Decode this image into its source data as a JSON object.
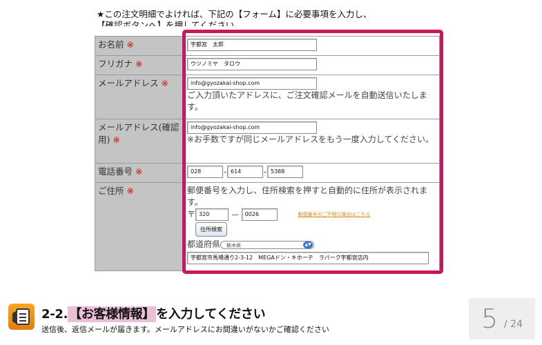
{
  "instruction": {
    "line1": "★この注文明細でよければ、下記の【フォーム】に必要事項を入力し、",
    "line2": "【確認ボタンへ】を押してください。"
  },
  "required_mark": "※",
  "form": {
    "name": {
      "label": "お名前",
      "value": "宇都宮　太郎"
    },
    "furigana": {
      "label": "フリガナ",
      "value": "ウツノミヤ　タロウ"
    },
    "email": {
      "label": "メールアドレス",
      "value": "info@gyozakai-shop.com",
      "note": "ご入力頂いたアドレスに、ご注文確認メールを自動送信いたします。"
    },
    "email_confirm": {
      "label": "メールアドレス(確認用)",
      "value": "info@gyozakai-shop.com",
      "note": "※お手数ですが同じメールアドレスをもう一度入力してください。"
    },
    "phone": {
      "label": "電話番号",
      "part1": "028",
      "part2": "614",
      "part3": "5388"
    },
    "address": {
      "label": "ご住所",
      "note": "郵便番号を入力し、住所検索を押すと自動的に住所が表示されます。",
      "zip_mark": "〒",
      "zip1": "320",
      "zip2": "0026",
      "zip_link": "郵便番号がご不明な場合はこちら",
      "search_button": "住所検索",
      "prefecture_label": "都道府県",
      "prefecture_value": "栃木県",
      "street": "宇都宮市馬場通り2-3-12　MEGAドン・キホーテ　ラパーク宇都宮店内"
    }
  },
  "footer": {
    "step": "2-2.",
    "title_highlight": "【お客様情報】",
    "title_rest": "を入力してください",
    "subtitle": "送信後、返信メールが届きます。メールアドレスにお間違いがないかご確認ください"
  },
  "page": {
    "current": "5",
    "total": "/ 24"
  },
  "colors": {
    "highlight_border": "#c8185d",
    "label_bg": "#c4c4c4",
    "icon_orange": "#f39a1a"
  }
}
